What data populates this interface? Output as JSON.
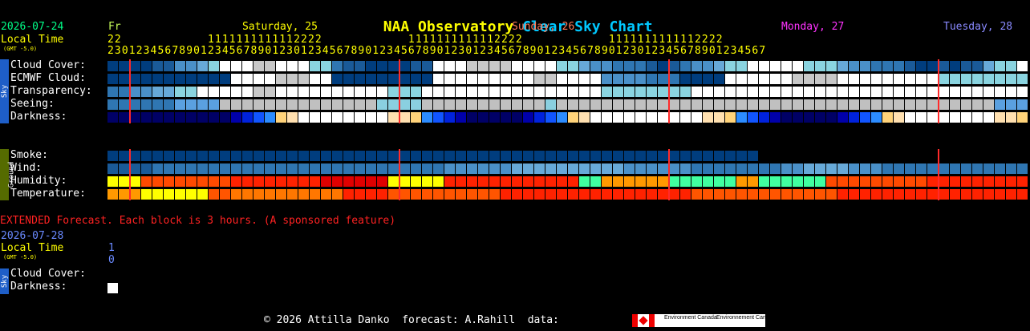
{
  "title": {
    "part1": "NAA Observatory",
    "part2": "Clear Sky Chart"
  },
  "header": {
    "date": "2026-07-24",
    "local_time": "Local Time",
    "gmt": "(GMT -5.0)",
    "day0": "Fr",
    "day1": "Saturday, 25",
    "day2": "Sunday, 26",
    "day3": "Monday, 27",
    "day4": "Tuesday, 28",
    "hours_tens": "22            1111111111112222            1111111111112222            1111111111112222",
    "hours_ones": "23012345678901234567890123012345678901234567890123012345678901234567890123012345678901234567"
  },
  "sky_tab": "Sky",
  "ground_tab": "Ground",
  "rows": {
    "cloud": "Cloud Cover:",
    "ecmwf": "ECMWF Cloud:",
    "transparency": "Transparency:",
    "seeing": "Seeing:",
    "darkness": "Darkness:",
    "smoke": "Smoke:",
    "wind": "Wind:",
    "humidity": "Humidity:",
    "temperature": "Temperature:"
  },
  "extended": {
    "note": "EXTENDED Forecast. Each block is 3 hours. (A sponsored feature)",
    "date": "2026-07-28",
    "local_time": "Local Time",
    "gmt": "(GMT -5.0)",
    "hour_tens": "1",
    "hour_ones": "0",
    "cloud": "Cloud Cover:",
    "darkness": "Darkness:"
  },
  "footer": {
    "credit": "© 2026 Attilla Danko  forecast: A.Rahill  data:",
    "logo_en": "Environment Canada",
    "logo_fr": "Environnement Canada"
  },
  "colors": {
    "title1": "#ffff00",
    "title2": "#00c8ff",
    "midnight_line": "#ff2a2a"
  },
  "palettes": {
    "cloud": [
      "#003d7e",
      "#1a5a98",
      "#2f76b2",
      "#4a90c8",
      "#67a9d8",
      "#8ad4e0",
      "#ffffff",
      "#c8c8c8"
    ],
    "darkness": [
      "#000066",
      "#0000aa",
      "#0022dd",
      "#1155ff",
      "#2c8cff",
      "#ffd37a",
      "#ffe0b0",
      "#ffffff"
    ],
    "seeing": [
      "#2f76b2",
      "#5aa0e0",
      "#8ad0e0",
      "#c0c0c0"
    ],
    "wind": [
      "#003d7e",
      "#1a5a98",
      "#2f76b2",
      "#4a90c8",
      "#67a9d8"
    ],
    "humidity": [
      "#ffff00",
      "#ff4a00",
      "#ff2200",
      "#e00000",
      "#40ffa0",
      "#ff9900"
    ],
    "temperature": [
      "#ff9900",
      "#ffff00",
      "#ff5500",
      "#ff2200",
      "#ff7700"
    ]
  },
  "grid": {
    "cloud": "00001133456667766655211000011666777766665543322210123345566666555433222100101145566665555566776665",
    "ecmwf": "000000000006666777660000000006666666667766663333222000066666677776666666665555555500000000000000",
    "transparency": "223344556666677666666666655566666666666666665555555566666666666666666666666666666666666666666666",
    "seeing": "000000111133333333333333222233333333333233333333333333333333333333333333333333311113333111133333",
    "darkness": "000000000001234567777777766543210000012345677777777776654321000001234567777777766543210000012345",
    "smoke": "000000000000000000000000000000000000000000000000000000000000000000000000000000000000000000000000",
    "wind": "111122222222222222222222222222333333444444444433333322222222334444333222222222222211111111111111",
    "humidity": "000111111112222222233333300000222222222222445555554444445544444411111111122222222222222222222222",
    "temperature": "000111111224444444444333322222222223333333333333333322222222222223333333333333333322222222222224"
  }
}
